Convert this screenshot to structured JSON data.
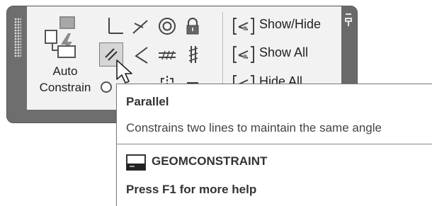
{
  "panel": {
    "auto_constrain": {
      "label_line1": "Auto",
      "label_line2": "Constrain",
      "icon": "auto-constrain-icon"
    },
    "tools": [
      {
        "name": "coincident",
        "icon": "coincident-icon"
      },
      {
        "name": "collinear",
        "icon": "collinear-icon"
      },
      {
        "name": "concentric",
        "icon": "concentric-icon"
      },
      {
        "name": "fix",
        "icon": "lock-icon"
      },
      {
        "name": "parallel",
        "icon": "parallel-icon",
        "active": true
      },
      {
        "name": "perpendicular",
        "icon": "perpendicular-icon"
      },
      {
        "name": "horizontal",
        "icon": "horizontal-icon"
      },
      {
        "name": "vertical",
        "icon": "vertical-icon"
      }
    ],
    "show_hide": {
      "show_hide_label": "Show/Hide",
      "show_all_label": "Show All",
      "hide_all_label": "Hide All"
    }
  },
  "tooltip": {
    "title": "Parallel",
    "description": "Constrains two lines to maintain the same angle",
    "command": "GEOMCONSTRAINT",
    "help": "Press F1 for more help"
  },
  "colors": {
    "panel_frame": "#6e6e6e",
    "panel_body": "#f2f2f2",
    "active_button": "#d6d6d6",
    "tooltip_border": "#777777"
  }
}
